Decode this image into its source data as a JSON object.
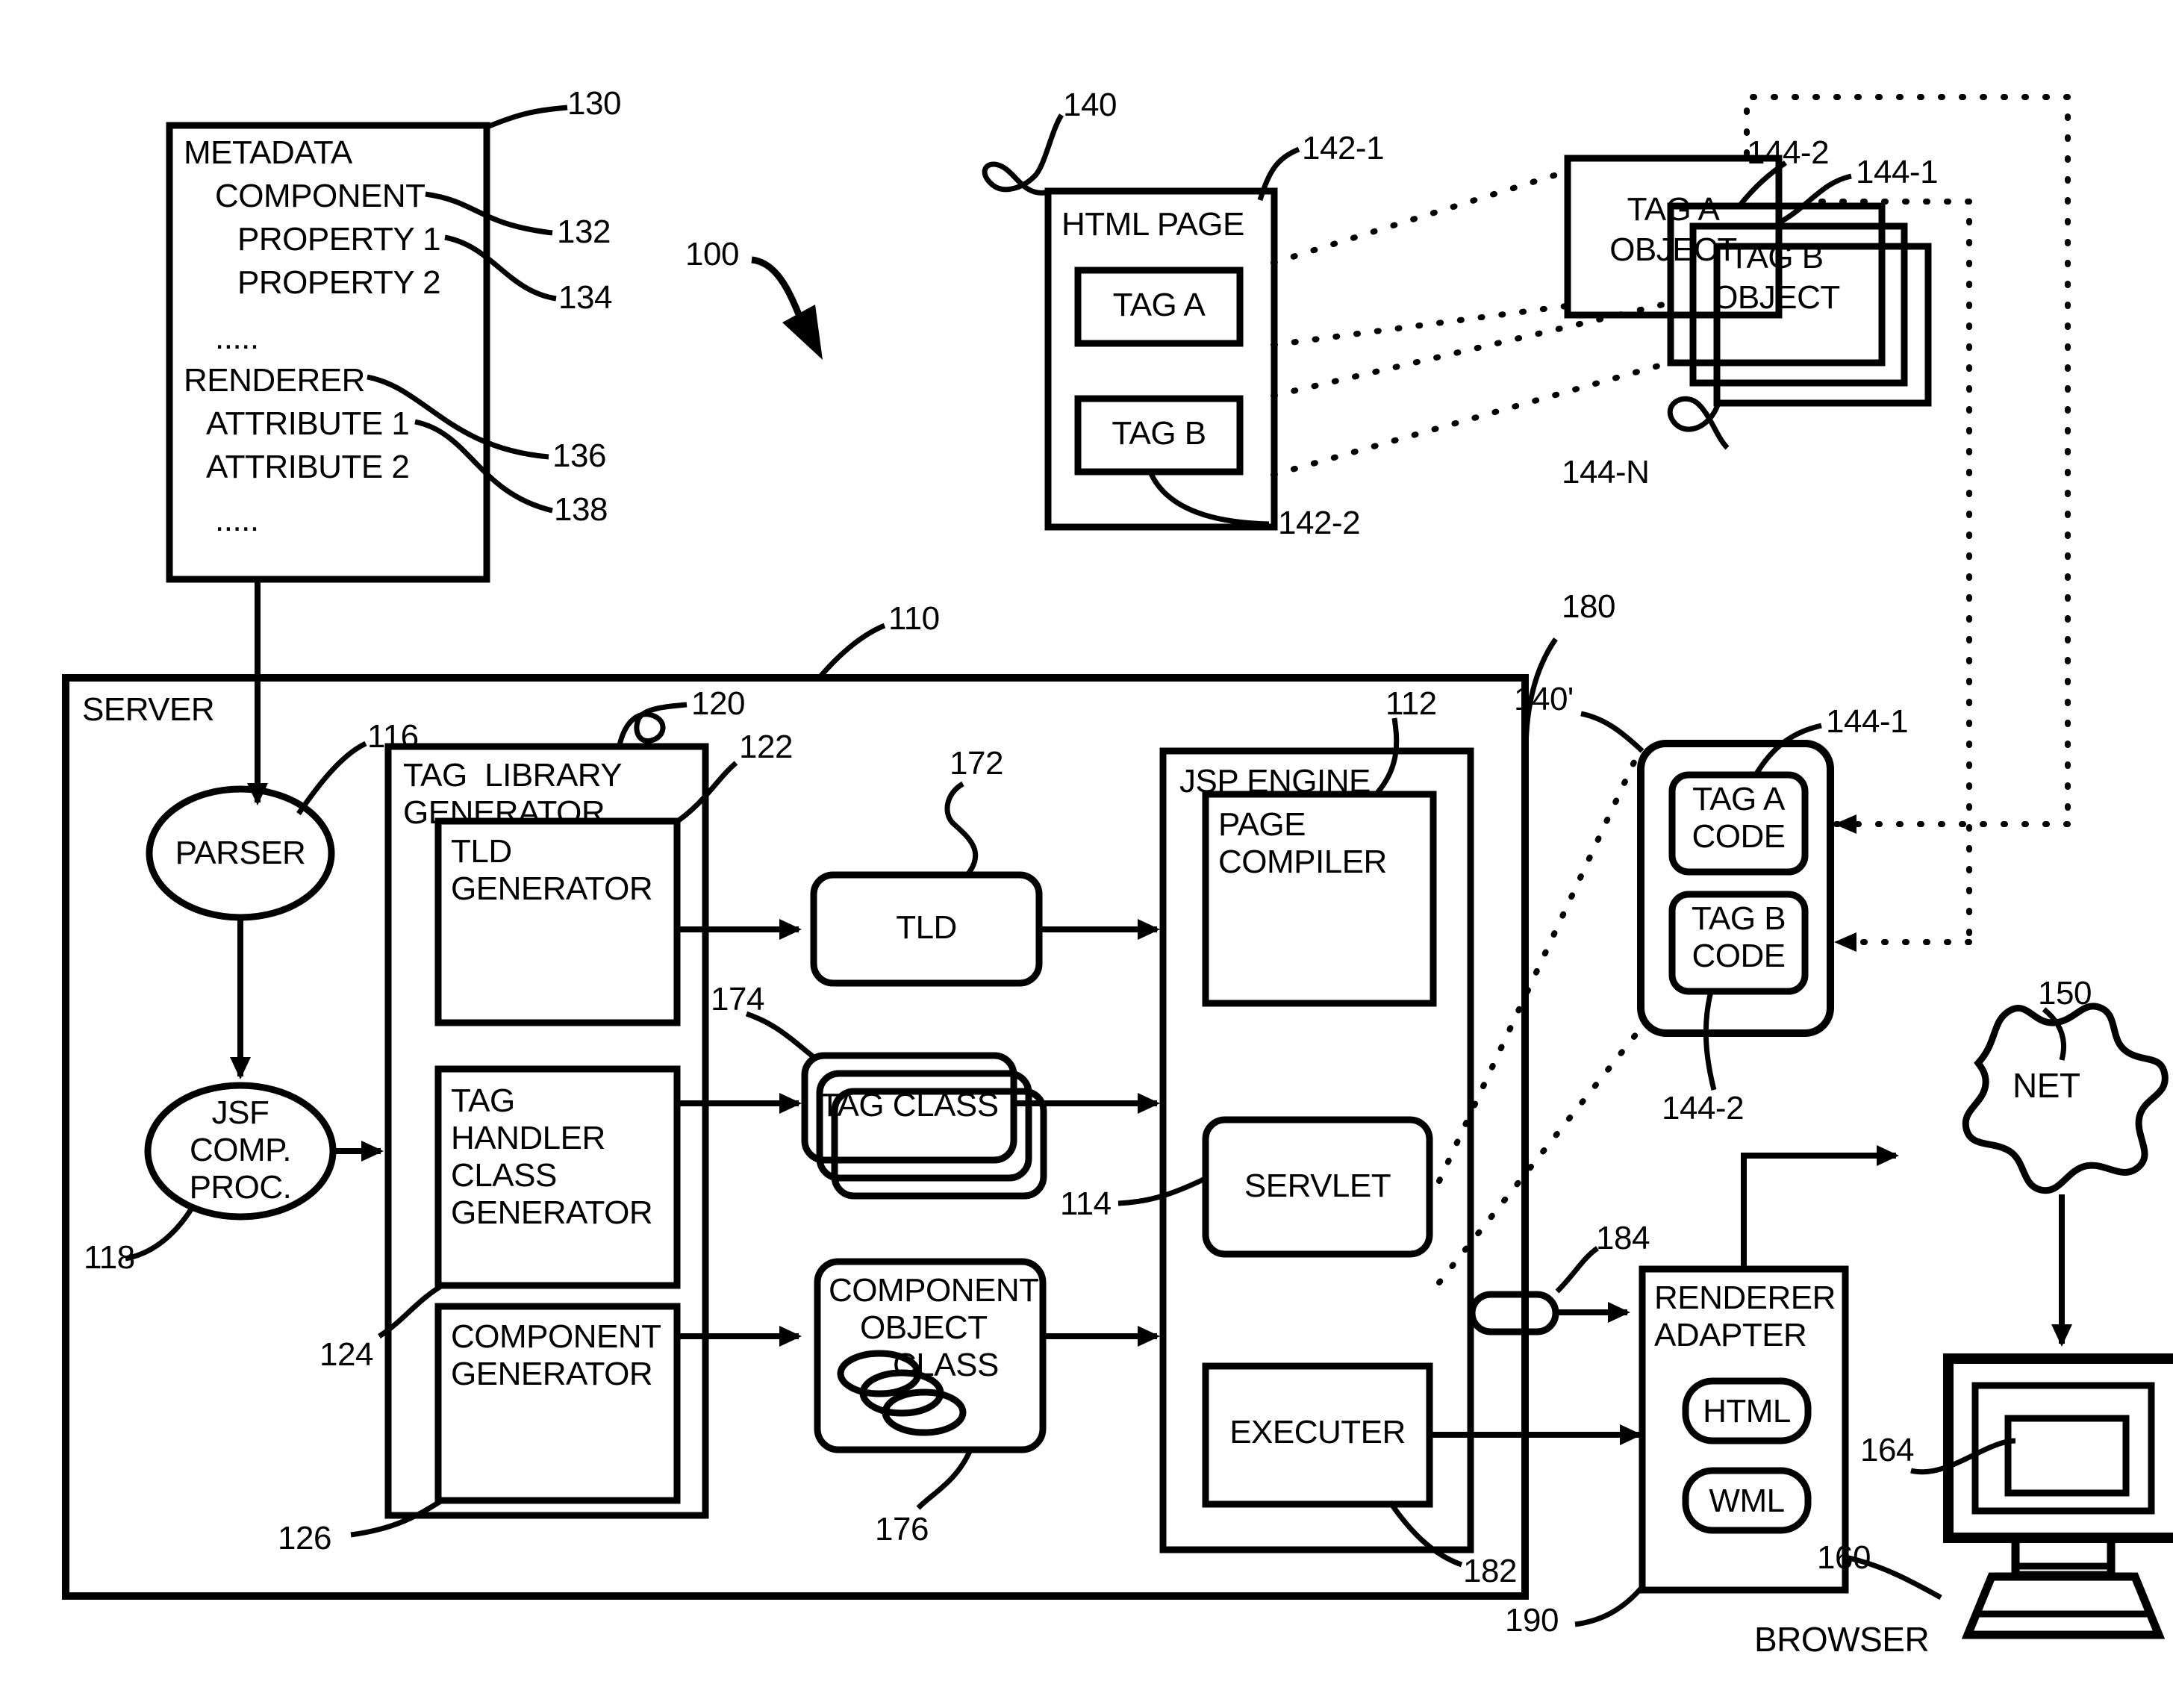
{
  "figure": {
    "system_ref": "100",
    "server_ref": "110"
  },
  "metadata_box": {
    "ref": "130",
    "title": "METADATA",
    "lines": [
      {
        "text": "COMPONENT",
        "indent": 1,
        "ref": "132"
      },
      {
        "text": "PROPERTY 1",
        "indent": 2,
        "ref": "134"
      },
      {
        "text": "PROPERTY 2",
        "indent": 2,
        "ref": ""
      },
      {
        "text": ".....",
        "indent": 1,
        "ref": ""
      },
      {
        "text": "RENDERER",
        "indent": 0,
        "ref": "136"
      },
      {
        "text": "ATTRIBUTE 1",
        "indent": 1,
        "ref": "138"
      },
      {
        "text": "ATTRIBUTE 2",
        "indent": 1,
        "ref": ""
      },
      {
        "text": ".....",
        "indent": 1,
        "ref": ""
      }
    ],
    "line_component": "COMPONENT",
    "line_property1": "PROPERTY 1",
    "line_property2": "PROPERTY 2",
    "ellipsis1": ".....",
    "line_renderer": "RENDERER",
    "line_attribute1": "ATTRIBUTE 1",
    "line_attribute2": "ATTRIBUTE 2",
    "ellipsis2": "....."
  },
  "html_page": {
    "ref": "140",
    "title": "HTML PAGE",
    "tag_a": {
      "label": "TAG A",
      "ref": "142-1"
    },
    "tag_b": {
      "label": "TAG B",
      "ref": "142-2"
    }
  },
  "tag_objects": {
    "tag_a_object": {
      "label_line1": "TAG A",
      "label_line2": "OBJECT",
      "ref": "144-1"
    },
    "tag_b_object": {
      "label_line1": "TAG B",
      "label_line2": "OBJECT",
      "ref": "144-2"
    },
    "stack_ref": "144-N"
  },
  "server": {
    "ref": "110",
    "title": "SERVER",
    "parser": {
      "label": "PARSER",
      "ref": "116"
    },
    "jsf_proc": {
      "line1": "JSF",
      "line2": "COMP.",
      "line3": "PROC.",
      "ref": "118"
    },
    "tag_library_generator": {
      "title_line1": "TAG  LIBRARY",
      "title_line2": "GENERATOR",
      "ref": "120",
      "tld_generator": {
        "line1": "TLD",
        "line2": "GENERATOR",
        "ref": "122"
      },
      "tag_handler_class_generator": {
        "line1": "TAG",
        "line2": "HANDLER",
        "line3": "CLASS",
        "line4": "GENERATOR",
        "ref": "124"
      },
      "component_generator": {
        "line1": "COMPONENT",
        "line2": "GENERATOR",
        "ref": "126"
      }
    },
    "tld": {
      "label": "TLD",
      "ref": "172"
    },
    "tag_class": {
      "label": "TAG CLASS",
      "ref": "174"
    },
    "component_object_class": {
      "line1": "COMPONENT",
      "line2": "OBJECT",
      "line3": "CLASS",
      "ref": "176"
    },
    "jsp_engine": {
      "title": "JSP ENGINE",
      "page_compiler": {
        "line1": "PAGE",
        "line2": "COMPILER",
        "ref": "112"
      },
      "servlet": {
        "label": "SERVLET",
        "ref": "114"
      },
      "executer": {
        "label": "EXECUTER",
        "ref": "182"
      }
    }
  },
  "tag_code_group": {
    "ref": "140'",
    "outer_ref": "180",
    "tag_a_code": {
      "line1": "TAG A",
      "line2": "CODE",
      "ref": "144-1"
    },
    "tag_b_code": {
      "line1": "TAG B",
      "line2": "CODE",
      "ref": "144-2"
    }
  },
  "renderer_adapter": {
    "line1": "RENDERER",
    "line2": "ADAPTER",
    "ref": "190",
    "connector_ref": "184",
    "html": "HTML",
    "wml": "WML"
  },
  "net": {
    "label": "NET",
    "ref": "150"
  },
  "browser": {
    "label": "BROWSER",
    "ref": "160",
    "screen_ref": "164"
  }
}
